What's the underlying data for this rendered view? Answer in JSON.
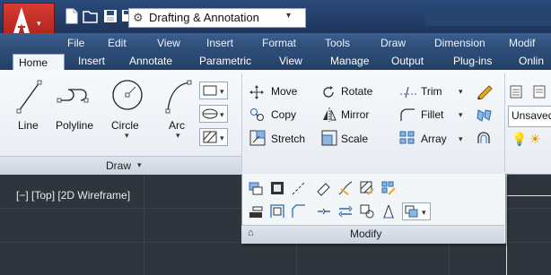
{
  "app": {
    "logo": "autocad-logo-icon"
  },
  "quick_access": {
    "icons": [
      "new-icon",
      "open-icon",
      "save-icon",
      "save-as-icon",
      "print-icon",
      "undo-icon",
      "undo-dropdown-icon",
      "redo-icon",
      "redo-dropdown-icon"
    ],
    "workspace": {
      "label": "Drafting & Annotation",
      "icon": "gear-icon"
    }
  },
  "menubar": {
    "items": [
      "File",
      "Edit",
      "View",
      "Insert",
      "Format",
      "Tools",
      "Draw",
      "Dimension",
      "Modif"
    ]
  },
  "tabs": {
    "active": "Home",
    "items": [
      "Insert",
      "Annotate",
      "Parametric",
      "View",
      "Manage",
      "Output",
      "Plug-ins",
      "Onlin"
    ]
  },
  "draw_panel": {
    "title": "Draw",
    "tools": [
      "Line",
      "Polyline",
      "Circle",
      "Arc"
    ]
  },
  "modify_panel": {
    "title": "Modify",
    "row1": [
      "Move",
      "Rotate",
      "Trim"
    ],
    "row2": [
      "Copy",
      "Mirror",
      "Fillet"
    ],
    "row3": [
      "Stretch",
      "Scale",
      "Array"
    ]
  },
  "layers_panel": {
    "unsaved_label": "Unsaved"
  },
  "viewport": {
    "label": "[−] [Top] [2D Wireframe]"
  },
  "colors": {
    "titlebar": "#1e355c",
    "ribbon": "#eef2f6",
    "viewport": "#2f353d",
    "logo": "#c2231c"
  }
}
